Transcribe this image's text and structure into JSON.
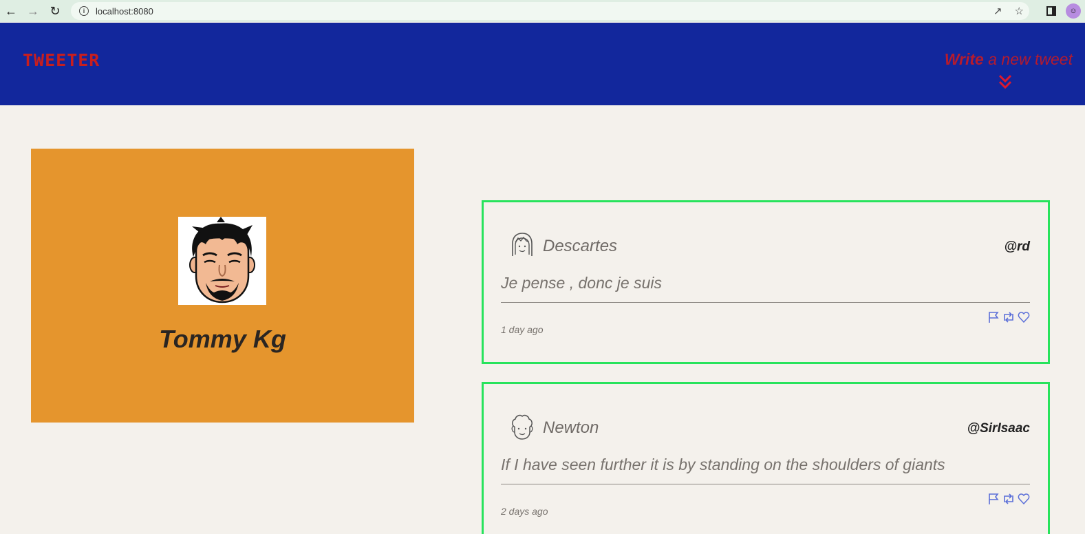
{
  "browser": {
    "url": "localhost:8080"
  },
  "header": {
    "logo": "TWEETER",
    "compose_bold": "Write",
    "compose_rest": " a new tweet"
  },
  "profile": {
    "name": "Tommy Kg"
  },
  "tweets": [
    {
      "author": "Descartes",
      "handle": "@rd",
      "text": "Je pense , donc je suis",
      "time": "1 day ago"
    },
    {
      "author": "Newton",
      "handle": "@SirIsaac",
      "text": "If I have seen further it is by standing on the shoulders of giants",
      "time": "2 days ago"
    }
  ],
  "colors": {
    "header_bg": "#12279c",
    "accent_red": "#c81e1e",
    "card_bg": "#e5952d",
    "tweet_border": "#27e35c",
    "action_icons": "#5b6fd8"
  }
}
